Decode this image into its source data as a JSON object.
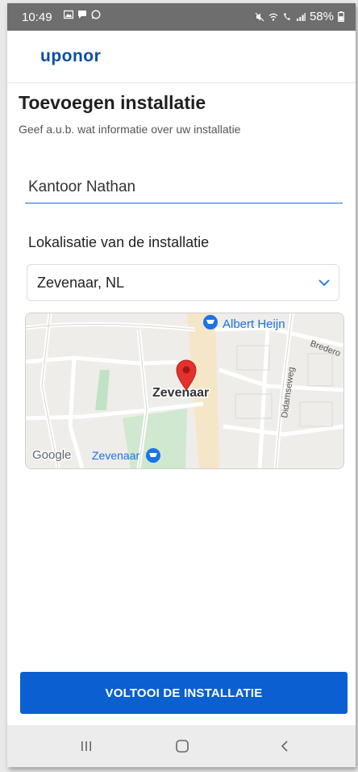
{
  "status_bar": {
    "time": "10:49",
    "battery": "58%"
  },
  "app": {
    "logo": "uponor"
  },
  "page": {
    "title": "Toevoegen installatie",
    "subtitle": "Geef a.u.b. wat informatie over uw installatie"
  },
  "form": {
    "installation_name_value": "Kantoor Nathan",
    "location_label": "Lokalisatie van de installatie",
    "location_selected": "Zevenaar, NL"
  },
  "map": {
    "city_label": "Zevenaar",
    "poi_albert_heijn": "Albert Heijn",
    "poi_zevenaar": "Zevenaar",
    "street_didamseweg": "Didamseweg",
    "street_bredero": "Bredero",
    "google_label": "Google",
    "pin_color": "#e3312b",
    "poi_color": "#1a73e8"
  },
  "actions": {
    "complete_label": "VOLTOOI DE INSTALLATIE"
  },
  "colors": {
    "brand": "#0b4ea2",
    "primary_button": "#0b5fd0"
  }
}
